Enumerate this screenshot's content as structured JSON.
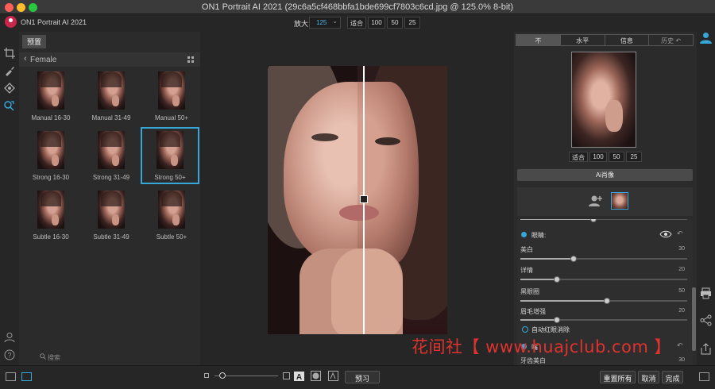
{
  "window": {
    "title": "ON1 Portrait AI 2021 (29c6a5cf468bbfa1bde699cf7803c6cd.jpg @ 125.0% 8-bit)"
  },
  "app": {
    "name": "ON1 Portrait AI 2021"
  },
  "zoom": {
    "label": "放大",
    "value": "125",
    "fit": "适合",
    "z100": "100",
    "z50": "50",
    "z25": "25"
  },
  "left_panel": {
    "tab": "预置",
    "category": "Female",
    "search_placeholder": "搜索",
    "presets": [
      {
        "label": "Manual 16-30"
      },
      {
        "label": "Manual 31-49"
      },
      {
        "label": "Manual 50+"
      },
      {
        "label": "Strong 16-30"
      },
      {
        "label": "Strong 31-49"
      },
      {
        "label": "Strong 50+",
        "selected": true
      },
      {
        "label": "Subtle 16-30"
      },
      {
        "label": "Subtle 31-49"
      },
      {
        "label": "Subtle 50+"
      }
    ]
  },
  "right_panel": {
    "tabs": [
      "不",
      "水平",
      "信息",
      "历史"
    ],
    "active_tab": "不",
    "nav_zoom": {
      "fit": "适合",
      "z100": "100",
      "z50": "50",
      "z25": "25"
    },
    "ai_header": "Ai肖像",
    "eyes_section": "眼睛:",
    "adjustments": [
      {
        "label": "美白",
        "value": "30",
        "level": 0.32
      },
      {
        "label": "详情",
        "value": "20",
        "level": 0.22
      },
      {
        "label": "黑眼圈",
        "value": "50",
        "level": 0.52
      },
      {
        "label": "眉毛增强",
        "value": "20",
        "level": 0.22
      }
    ],
    "auto_redeye": "自动红眼消除",
    "mouth_section": "嘴",
    "teeth_label": "牙齿美白",
    "teeth_value": "30"
  },
  "bottom": {
    "preview": "预习",
    "reset_all": "重置所有",
    "cancel": "取消",
    "done": "完成"
  },
  "watermark": "花间社【 www.huajclub.com 】",
  "colors": {
    "accent": "#35a7d9",
    "brand": "#c8264a",
    "watermark": "#e0322e"
  }
}
